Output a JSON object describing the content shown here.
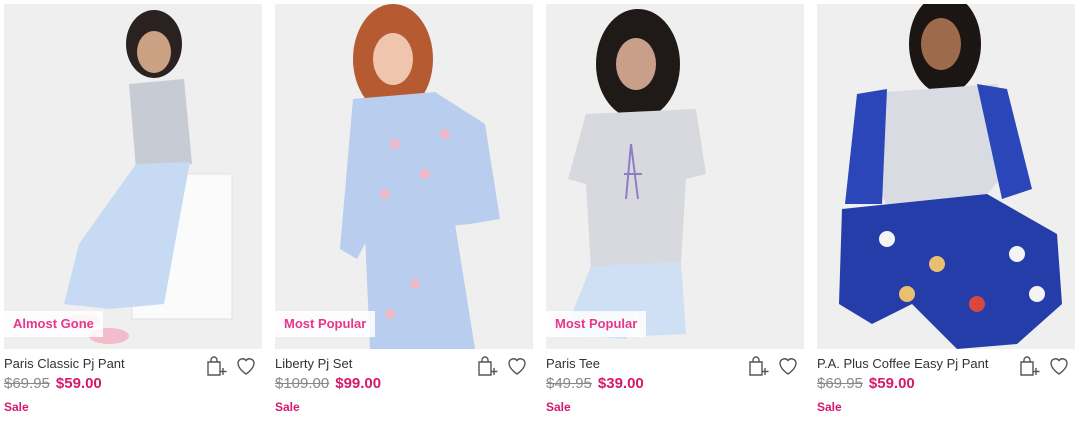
{
  "products": [
    {
      "name": "Paris Classic Pj Pant",
      "badge": "Almost Gone",
      "old_price": "$69.95",
      "new_price": "$59.00",
      "sale": "Sale"
    },
    {
      "name": "Liberty Pj Set",
      "badge": "Most Popular",
      "old_price": "$109.00",
      "new_price": "$99.00",
      "sale": "Sale"
    },
    {
      "name": "Paris Tee",
      "badge": "Most Popular",
      "old_price": "$49.95",
      "new_price": "$39.00",
      "sale": "Sale"
    },
    {
      "name": "P.A. Plus Coffee Easy Pj Pant",
      "badge": "",
      "old_price": "$69.95",
      "new_price": "$59.00",
      "sale": "Sale"
    }
  ],
  "icons": {
    "bag": "add-to-bag-icon",
    "wishlist": "heart-icon"
  },
  "colors": {
    "accent": "#d6196e",
    "badge_text": "#e8358d",
    "old_price": "#888888"
  }
}
